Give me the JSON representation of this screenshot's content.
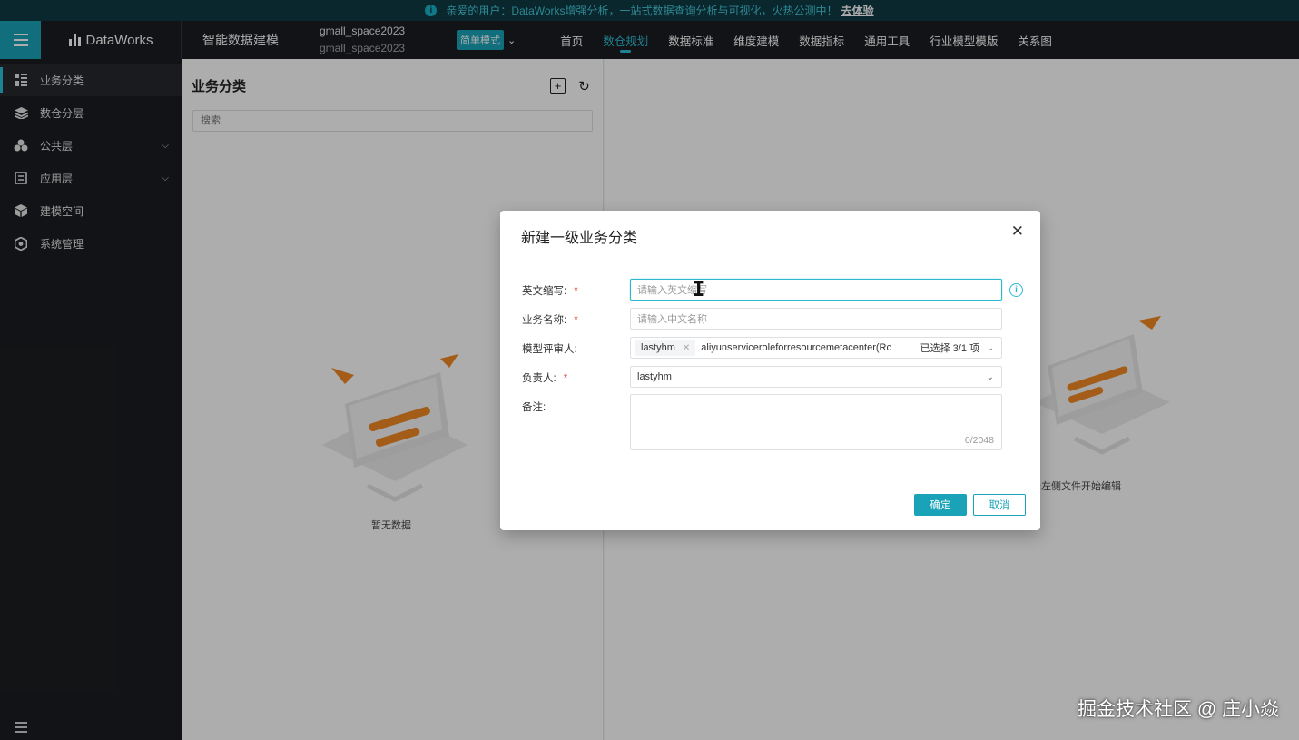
{
  "announcement": {
    "text": "亲爱的用户：DataWorks增强分析，一站式数据查询分析与可视化，火热公测中！",
    "link": "去体验"
  },
  "header": {
    "brand": "DataWorks",
    "product": "智能数据建模",
    "workspace_name": "gmall_space2023",
    "workspace_sub": "gmall_space2023",
    "mode": "简单模式",
    "nav": [
      "首页",
      "数仓规划",
      "数据标准",
      "维度建模",
      "数据指标",
      "通用工具",
      "行业模型模版",
      "关系图"
    ],
    "active_nav": "数仓规划"
  },
  "sidebar": {
    "items": [
      {
        "label": "业务分类",
        "icon": "grid-list-icon"
      },
      {
        "label": "数仓分层",
        "icon": "layers-icon"
      },
      {
        "label": "公共层",
        "icon": "cubes-icon"
      },
      {
        "label": "应用层",
        "icon": "table-icon"
      },
      {
        "label": "建模空间",
        "icon": "box-icon"
      },
      {
        "label": "系统管理",
        "icon": "gear-hex-icon"
      }
    ]
  },
  "panel": {
    "title": "业务分类",
    "search_placeholder": "搜索",
    "empty_text": "暂无数据"
  },
  "main": {
    "empty_text": "击左侧文件开始编辑"
  },
  "dialog": {
    "title": "新建一级业务分类",
    "fields": {
      "abbr_label": "英文缩写:",
      "abbr_placeholder": "请输入英文缩写",
      "name_label": "业务名称:",
      "name_placeholder": "请输入中文名称",
      "reviewer_label": "模型评审人:",
      "reviewer_tag": "lastyhm",
      "reviewer_long": "aliyunserviceroleforresourcemetacenter(Rc",
      "reviewer_count": "已选择 3/1 项",
      "owner_label": "负责人:",
      "owner_value": "lastyhm",
      "note_label": "备注:",
      "note_count": "0/2048"
    },
    "ok": "确定",
    "cancel": "取消"
  },
  "watermark": "掘金技术社区 @ 庄小焱",
  "colors": {
    "accent": "#1aa3b8",
    "dark_bg": "#1b1d21",
    "announce_bg": "#0f3a44",
    "required": "#e0443c"
  }
}
